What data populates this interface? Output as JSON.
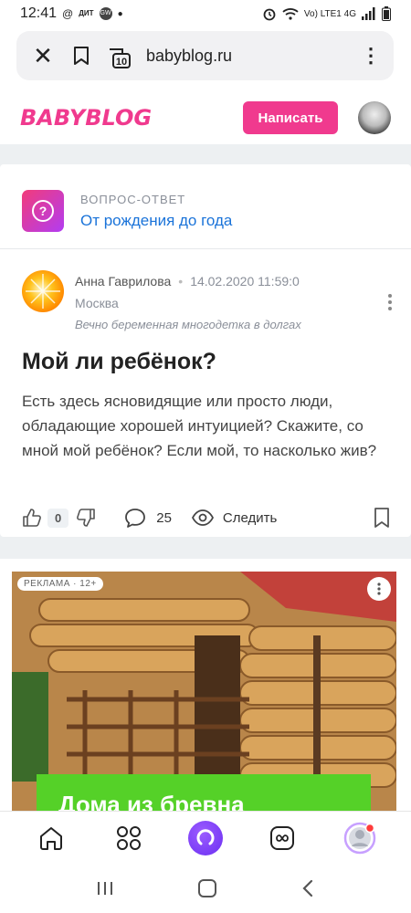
{
  "status_bar": {
    "time": "12:41",
    "left_icons": [
      "at-icon",
      "dit-mir-icon",
      "gw-icon",
      "dot-icon"
    ],
    "gw_label": "GW",
    "dit_label": "ДИТ",
    "right_text": "Vo) LTE1 4G"
  },
  "browser": {
    "url": "babyblog.ru",
    "tab_count": "10"
  },
  "site": {
    "logo": "BABYBLOG",
    "write_button": "Написать"
  },
  "post": {
    "category_label": "ВОПРОС-ОТВЕТ",
    "category_title": "От рождения до года",
    "author_name": "Анна Гаврилова",
    "date": "14.02.2020 11:59:0",
    "city": "Москва",
    "author_status": "Вечно беременная многодетка в долгах",
    "title": "Мой ли ребёнок?",
    "body": "Есть здесь ясновидящие или просто люди, обладающие хорошей интуицией? Скажите, со мной мой ребёнок? Если мой, то насколько жив?",
    "likes": "0",
    "comments": "25",
    "follow_label": "Следить"
  },
  "ad": {
    "badge": "РЕКЛАМА · 12+",
    "headline": "Дома из бревна"
  },
  "colors": {
    "brand_pink": "#f03a8e",
    "link_blue": "#1a73d9",
    "ad_green": "#55d128"
  }
}
